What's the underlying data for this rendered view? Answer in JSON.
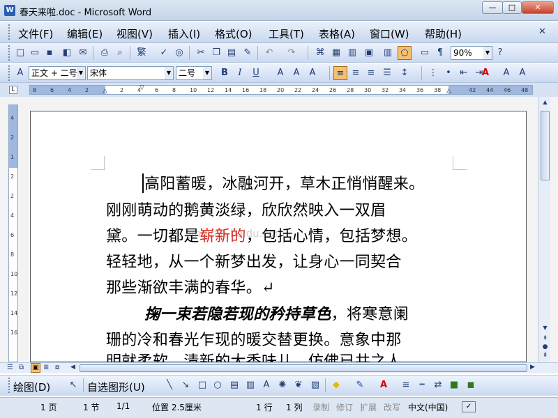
{
  "window": {
    "title": "春天来啦.doc - Microsoft Word",
    "app_icon": "W"
  },
  "window_controls": {
    "minimize": "—",
    "maximize": "□",
    "close": "✕"
  },
  "menu": {
    "items": [
      "文件(F)",
      "编辑(E)",
      "视图(V)",
      "插入(I)",
      "格式(O)",
      "工具(T)",
      "表格(A)",
      "窗口(W)",
      "帮助(H)"
    ],
    "close_doc": "✕"
  },
  "standard_toolbar": {
    "zoom": "90%"
  },
  "formatting_toolbar": {
    "style": "正文 + 二号",
    "font": "宋体",
    "size": "二号"
  },
  "ruler": {
    "ticks": [
      "8",
      "6",
      "4",
      "2",
      "",
      "2",
      "4",
      "6",
      "8",
      "10",
      "12",
      "14",
      "16",
      "18",
      "20",
      "22",
      "24",
      "26",
      "28",
      "30",
      "32",
      "34",
      "36",
      "38",
      "",
      "42",
      "44",
      "46",
      "48"
    ]
  },
  "vertical_ruler": {
    "ticks": [
      "4",
      "2",
      "1",
      "2",
      "2",
      "4",
      "6",
      "8",
      "10",
      "12",
      "14",
      "16"
    ]
  },
  "document": {
    "lines": [
      "高阳蓄暖，冰融河开，草木正悄悄醒来。",
      "刚刚萌动的鹅黄淡绿，欣欣然映入一双眉",
      "黛。一切都是",
      "崭新的",
      "，包括心情，包括梦想。",
      "轻轻地，从一个新梦出发，让身心一同契合",
      "那些渐欲丰满的春华。↵",
      "掬一束若隐若现的矜持草色",
      "，将寒意阑",
      "珊的冷和春光乍现的暖交替更换。意象中那",
      "明就柔软，清新的大香味儿，仿佛已共之人"
    ],
    "highlight_color": "#e0251b",
    "watermark": "jingyan.baidu.com"
  },
  "drawing_toolbar": {
    "draw": "绘图(D)",
    "autoshapes": "自选图形(U)"
  },
  "status_bar": {
    "page": "1 页",
    "section": "1 节",
    "page_of": "1/1",
    "position": "位置 2.5厘米",
    "line": "1 行",
    "column": "1 列",
    "rec": "录制",
    "trk": "修订",
    "ext": "扩展",
    "ovr": "改写",
    "language": "中文(中国)"
  }
}
